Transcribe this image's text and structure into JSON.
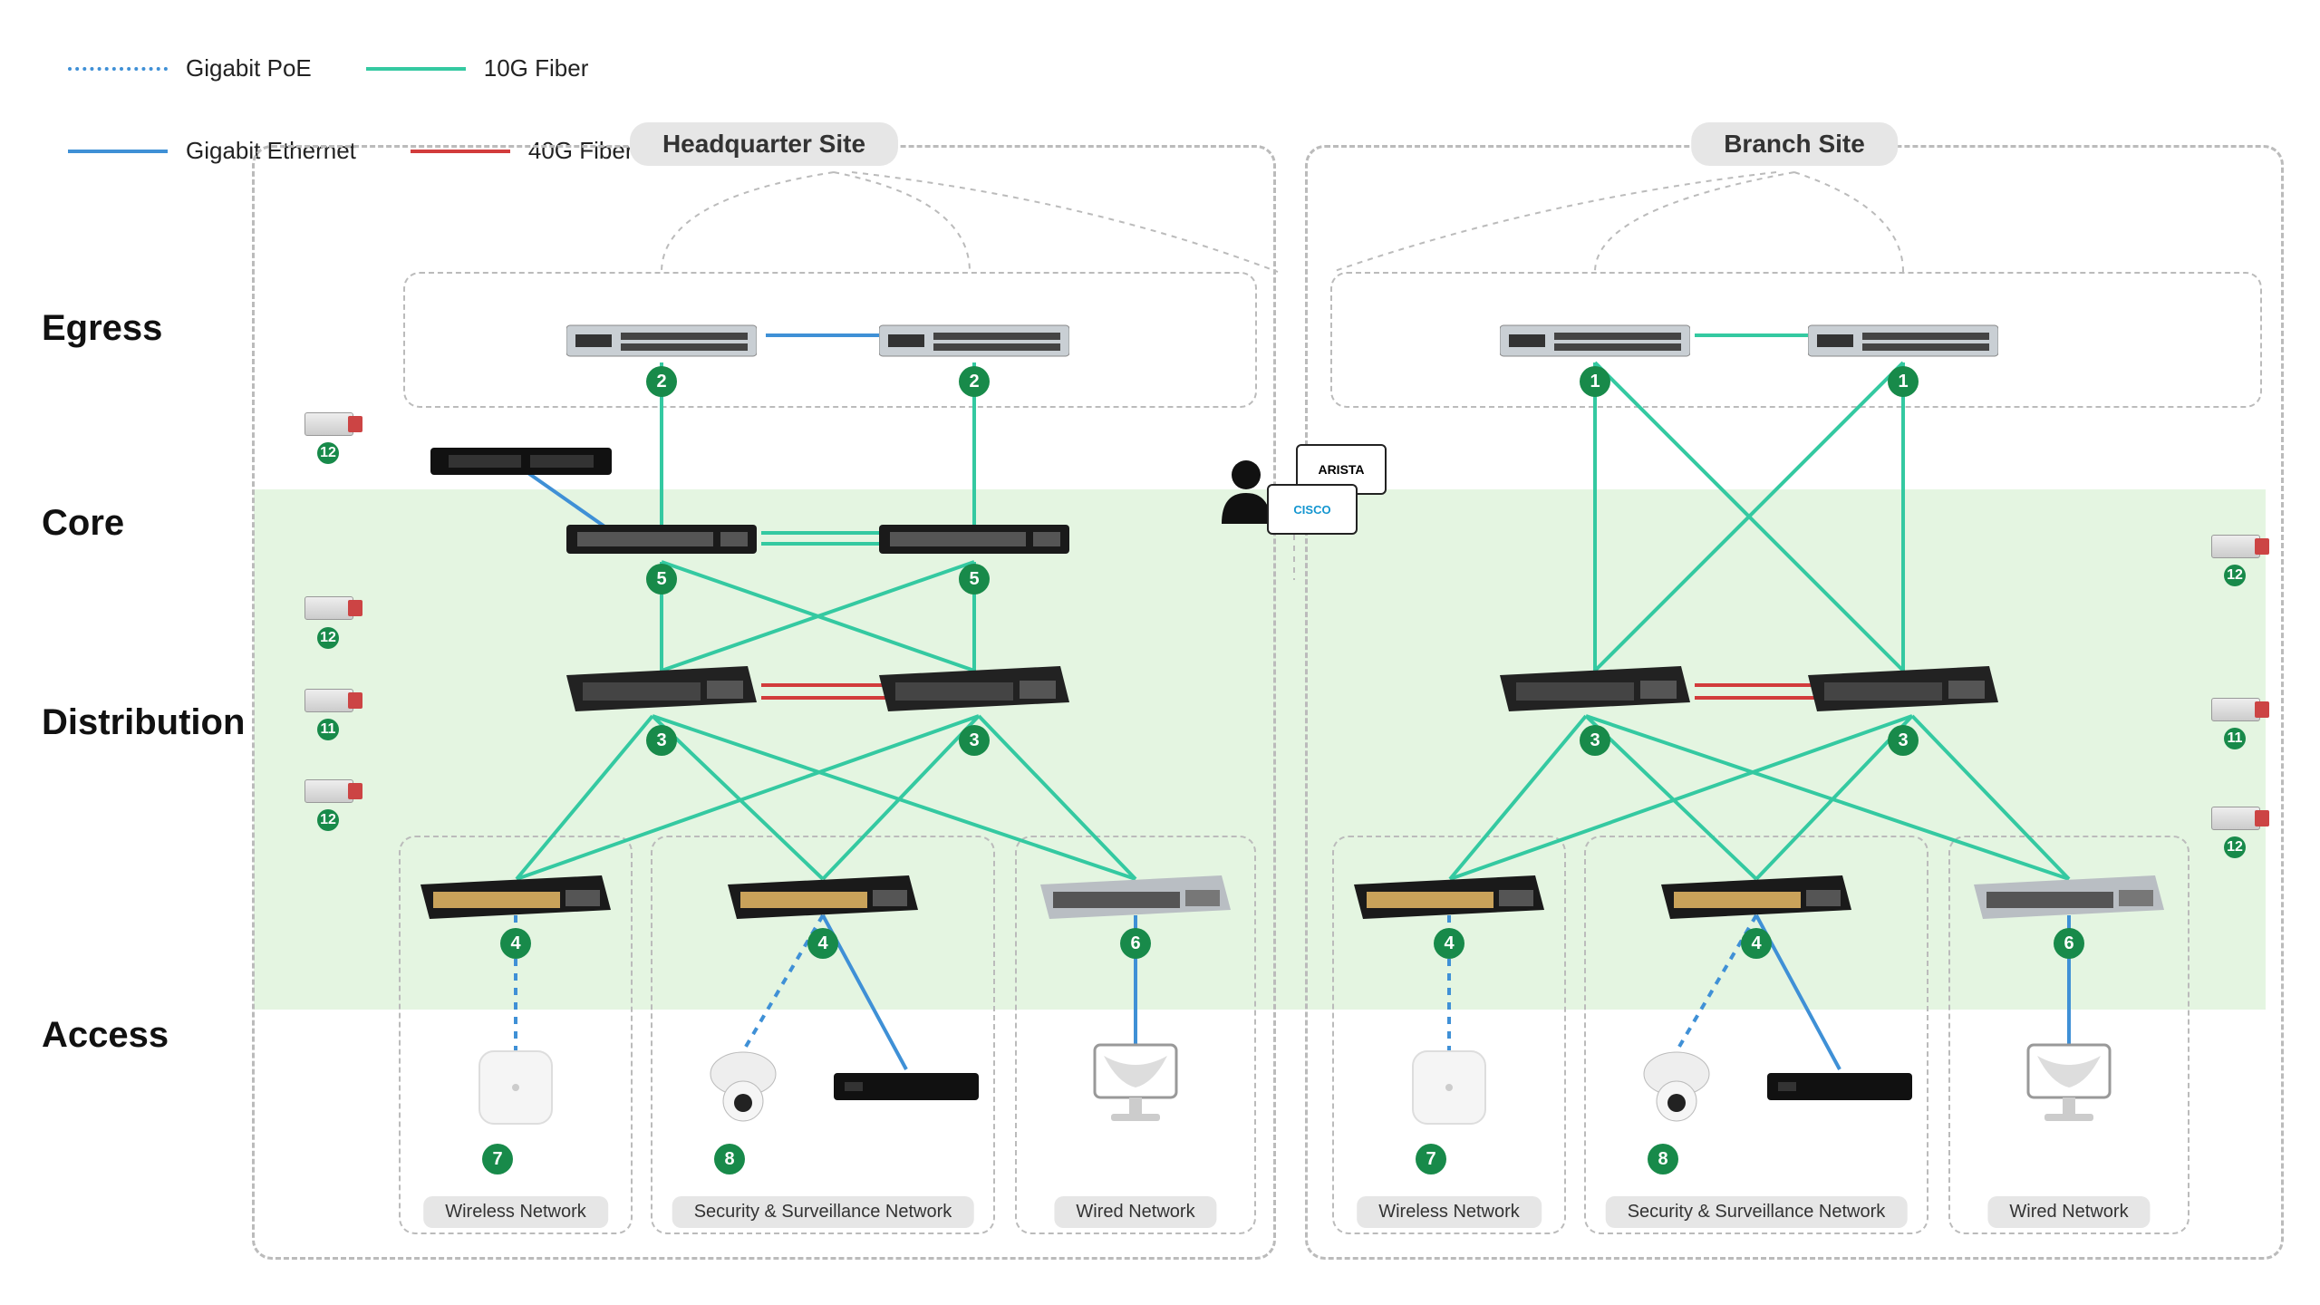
{
  "legend": {
    "items": [
      {
        "label": "Gigabit PoE",
        "style": "dotted",
        "color": "#3f90d6"
      },
      {
        "label": "10G Fiber",
        "style": "solid",
        "color": "#34c9a1"
      },
      {
        "label": "Gigabit Ethernet",
        "style": "solid",
        "color": "#3f90d6"
      },
      {
        "label": "40G Fiber",
        "style": "solid",
        "color": "#d23c3c"
      }
    ]
  },
  "layers": {
    "egress": "Egress",
    "core": "Core",
    "distribution": "Distribution",
    "access": "Access"
  },
  "sites": {
    "hq": {
      "label": "Headquarter Site"
    },
    "branch": {
      "label": "Branch Site"
    }
  },
  "sublabels": {
    "wireless": "Wireless Network",
    "security": "Security & Surveillance Network",
    "wired": "Wired Network"
  },
  "vendors": {
    "arista": "ARISTA",
    "cisco": "CISCO"
  },
  "badges": {
    "hq_egress": "2",
    "br_egress": "1",
    "hq_core": "5",
    "distribution": "3",
    "access_poe": "4",
    "access_wired": "6",
    "wireless_ap": "7",
    "camera": "8",
    "module_sfp": "12",
    "module_qsfp": "11"
  },
  "colors": {
    "gigPoE": "#3f90d6",
    "gigEth": "#3f90d6",
    "tenG": "#34c9a1",
    "fortyG": "#d23c3c",
    "badge": "#188a4a"
  }
}
